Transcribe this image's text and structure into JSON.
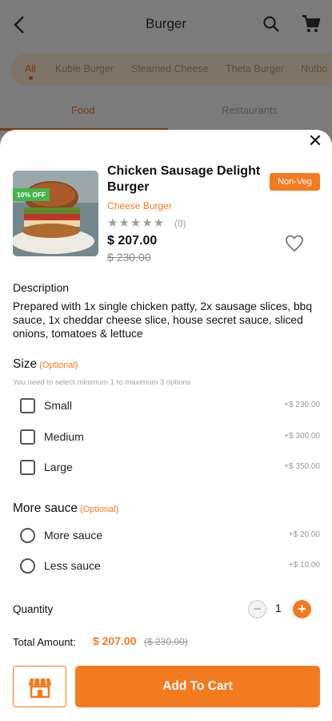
{
  "header": {
    "title": "Burger",
    "back_icon": "arrow-left-icon",
    "search_icon": "search-icon",
    "cart_icon": "cart-icon"
  },
  "categories": [
    {
      "label": "All",
      "active": true
    },
    {
      "label": "Kubie Burger",
      "active": false
    },
    {
      "label": "Steamed Cheese",
      "active": false
    },
    {
      "label": "Theta Burger",
      "active": false
    },
    {
      "label": "Nutbo",
      "active": false
    }
  ],
  "tabs": [
    {
      "label": "Food",
      "active": true
    },
    {
      "label": "Restaurants",
      "active": false
    }
  ],
  "product": {
    "discount_badge": "10% OFF",
    "name": "Chicken Sausage Delight Burger",
    "diet_badge": "Non-Veg",
    "category": "Cheese Burger",
    "stars": "★★★★★",
    "rating_value": 0,
    "rating_count": "(0)",
    "price": "$ 207.00",
    "old_price": "$ 230.00",
    "favorite_icon": "heart-outline-icon"
  },
  "description": {
    "heading": "Description",
    "text": "Prepared with 1x single chicken patty, 2x sausage slices, bbq sauce, 1x cheddar cheese slice, house secret sauce, sliced onions, tomatoes & lettuce"
  },
  "size_section": {
    "title": "Size",
    "optional_label": "(Optional)",
    "hint": "You need to select minimum 1 to maximum 3 options",
    "options": [
      {
        "label": "Small",
        "price": "+$ 230.00",
        "checked": false
      },
      {
        "label": "Medium",
        "price": "+$ 300.00",
        "checked": false
      },
      {
        "label": "Large",
        "price": "+$ 350.00",
        "checked": false
      }
    ]
  },
  "sauce_section": {
    "title": "More sauce",
    "optional_label": "(Optional)",
    "options": [
      {
        "label": "More sauce",
        "price": "+$ 20.00",
        "selected": false
      },
      {
        "label": "Less sauce",
        "price": "+$ 10.00",
        "selected": false
      }
    ]
  },
  "quantity": {
    "label": "Quantity",
    "value": "1",
    "minus": "−",
    "plus": "+"
  },
  "total": {
    "label": "Total Amount:",
    "price": "$ 207.00",
    "old_price": "($ 230.00)"
  },
  "actions": {
    "store_icon": "store-icon",
    "add_to_cart": "Add To Cart",
    "close": "✕"
  },
  "colors": {
    "accent": "#f47a20",
    "discount_green": "#43b549"
  }
}
